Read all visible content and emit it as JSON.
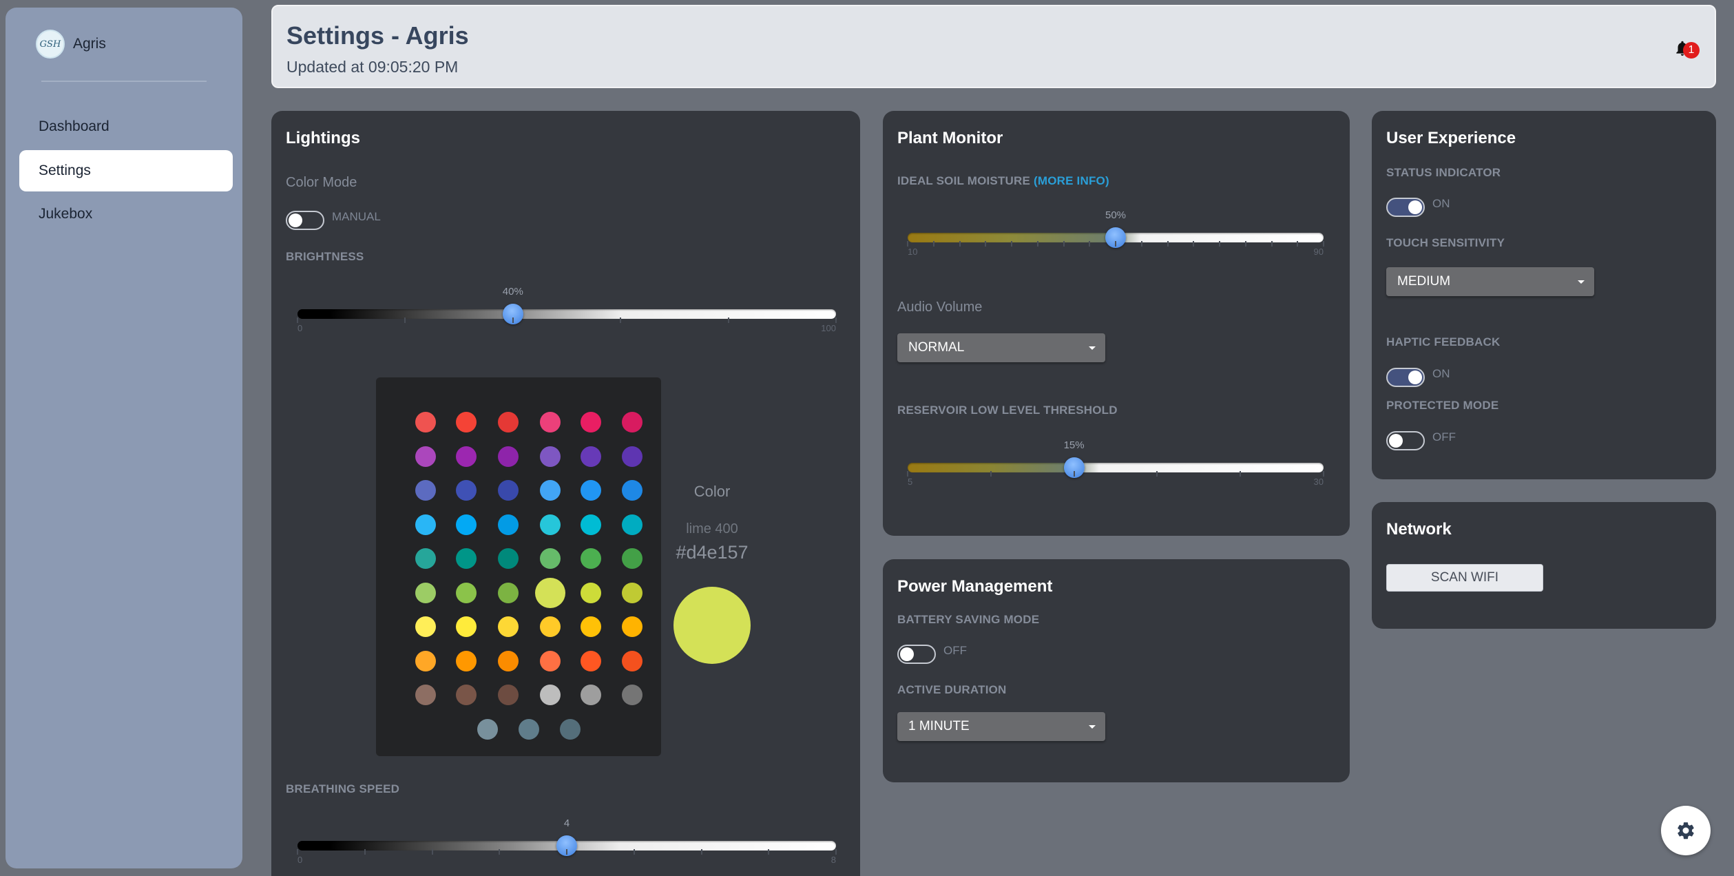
{
  "sidebar": {
    "brand": {
      "logo_text": "GSH",
      "name": "Agris"
    },
    "items": [
      {
        "label": "Dashboard",
        "active": false
      },
      {
        "label": "Settings",
        "active": true
      },
      {
        "label": "Jukebox",
        "active": false
      }
    ]
  },
  "header": {
    "title": "Settings - Agris",
    "subtitle": "Updated at 09:05:20 PM",
    "notification_count": "1"
  },
  "lightings": {
    "title": "Lightings",
    "color_mode_label": "Color Mode",
    "color_mode_toggle": {
      "state": "off",
      "text": "MANUAL"
    },
    "brightness": {
      "label": "BRIGHTNESS",
      "value": 40,
      "value_text": "40%",
      "min": "0",
      "max": "100"
    },
    "palette": {
      "colors": [
        [
          "#ef5350",
          "#f44336",
          "#e53935",
          "#ec407a",
          "#e91e63",
          "#d81b60"
        ],
        [
          "#ab47bc",
          "#9c27b0",
          "#8e24aa",
          "#7e57c2",
          "#673ab7",
          "#5e35b1"
        ],
        [
          "#5c6bc0",
          "#3f51b5",
          "#3949ab",
          "#42a5f5",
          "#2196f3",
          "#1e88e5"
        ],
        [
          "#29b6f6",
          "#03a9f4",
          "#039be5",
          "#26c6da",
          "#00bcd4",
          "#00acc1"
        ],
        [
          "#26a69a",
          "#009688",
          "#00897b",
          "#66bb6a",
          "#4caf50",
          "#43a047"
        ],
        [
          "#9ccc65",
          "#8bc34a",
          "#7cb342",
          "#d4e157",
          "#cddc39",
          "#c0ca33"
        ],
        [
          "#ffee58",
          "#ffeb3b",
          "#fdd835",
          "#ffca28",
          "#ffc107",
          "#ffb300"
        ],
        [
          "#ffa726",
          "#ff9800",
          "#fb8c00",
          "#ff7043",
          "#ff5722",
          "#f4511e"
        ],
        [
          "#8d6e63",
          "#795548",
          "#6d4c41",
          "#bdbdbd",
          "#9e9e9e",
          "#757575"
        ],
        [
          "#78909c",
          "#607d8b",
          "#546e7a"
        ]
      ],
      "selected": "#d4e157"
    },
    "color": {
      "label": "Color",
      "name": "lime 400",
      "hex": "#d4e157"
    },
    "breathing_speed": {
      "label": "BREATHING SPEED",
      "value": 4,
      "value_text": "4",
      "min": "0",
      "max": "8"
    }
  },
  "plant_monitor": {
    "title": "Plant Monitor",
    "soil_label": "IDEAL SOIL MOISTURE",
    "soil_more_info": "(MORE INFO)",
    "soil": {
      "value": 50,
      "value_text": "50%",
      "min": "10",
      "max": "90"
    },
    "audio_label": "Audio Volume",
    "audio_select": "NORMAL",
    "reservoir_label": "RESERVOIR LOW LEVEL THRESHOLD",
    "reservoir": {
      "value": 15,
      "value_text": "15%",
      "min": "5",
      "max": "30"
    }
  },
  "power": {
    "title": "Power Management",
    "battery_label": "BATTERY SAVING MODE",
    "battery_toggle": {
      "state": "off",
      "text": "OFF"
    },
    "active_label": "ACTIVE DURATION",
    "active_select": "1 MINUTE"
  },
  "user_experience": {
    "title": "User Experience",
    "status_label": "STATUS INDICATOR",
    "status_toggle": {
      "state": "on",
      "text": "ON"
    },
    "touch_label": "TOUCH SENSITIVITY",
    "touch_select": "MEDIUM",
    "haptic_label": "HAPTIC FEEDBACK",
    "haptic_toggle": {
      "state": "on",
      "text": "ON"
    },
    "protected_label": "PROTECTED MODE",
    "protected_toggle": {
      "state": "off",
      "text": "OFF"
    }
  },
  "network": {
    "title": "Network",
    "scan_button": "SCAN WIFI"
  },
  "colors": {
    "accent": "#3d7fe0",
    "toggle_on": "#44527e",
    "badge": "#e11d1d"
  }
}
